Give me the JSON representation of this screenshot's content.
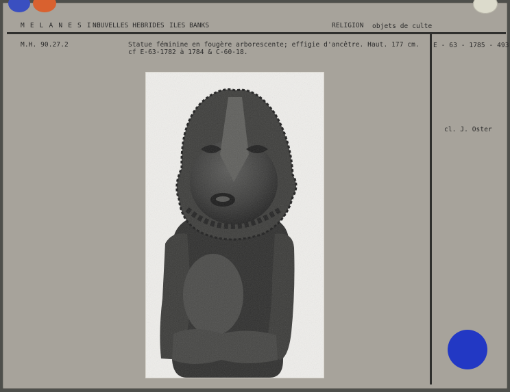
{
  "header": {
    "region": "M E L A N E S I E",
    "islands": "NOUVELLES HEBRIDES",
    "subgroup": "ILES BANKS",
    "theme": "RELIGION",
    "category": "objets de culte"
  },
  "record": {
    "inventory_number": "M.H. 90.27.2",
    "description_line1": "Statue féminine en fougère arborescente; effigie d'ancêtre. Haut. 177 cm.",
    "description_line2": "cf E-63-1782 à 1784 & C-60-18.",
    "negative_number": "E - 63 - 1785 - 493",
    "credit": "cl. J. Oster"
  },
  "photo": {
    "subject": "carved tree-fern ancestor statue"
  },
  "colors": {
    "card": "#a7a39b",
    "sticker_blue": "#1f3fb8",
    "sticker_orange": "#d9572b",
    "sticker_pale": "#d8d6c8"
  }
}
